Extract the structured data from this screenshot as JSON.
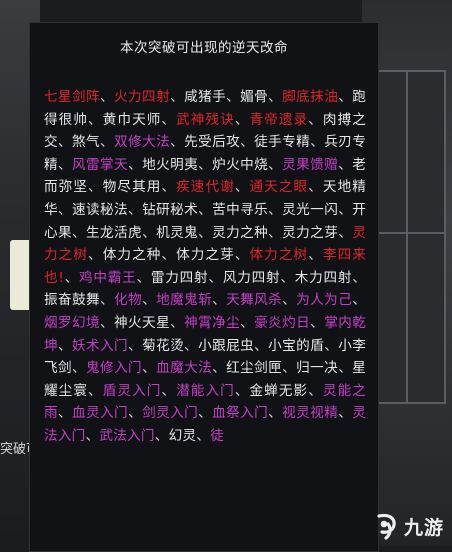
{
  "panel": {
    "title": "本次突破可出现的逆天改命"
  },
  "background": {
    "caption": "突破可"
  },
  "colors": {
    "red": "#e0242a",
    "purple": "#c43ec8",
    "white": "#e6e6e6",
    "separator": "#d4d4d4"
  },
  "separator": "、",
  "skills": [
    {
      "name": "七星剑阵",
      "color": "red"
    },
    {
      "name": "火力四射",
      "color": "red"
    },
    {
      "name": "咸猪手",
      "color": "white"
    },
    {
      "name": "媚骨",
      "color": "white"
    },
    {
      "name": "脚底抹油",
      "color": "red"
    },
    {
      "name": "跑得很帅",
      "color": "white"
    },
    {
      "name": "黄巾天师",
      "color": "white"
    },
    {
      "name": "武神残诀",
      "color": "red"
    },
    {
      "name": "青帝遗录",
      "color": "red"
    },
    {
      "name": "肉搏之交",
      "color": "white"
    },
    {
      "name": "煞气",
      "color": "white"
    },
    {
      "name": "双修大法",
      "color": "purple"
    },
    {
      "name": "先受后攻",
      "color": "white"
    },
    {
      "name": "徒手专精",
      "color": "white"
    },
    {
      "name": "兵刃专精",
      "color": "white"
    },
    {
      "name": "风雷掌天",
      "color": "purple"
    },
    {
      "name": "地火明夷",
      "color": "white"
    },
    {
      "name": "炉火中烧",
      "color": "white"
    },
    {
      "name": "灵果馈赠",
      "color": "purple"
    },
    {
      "name": "老而弥坚",
      "color": "white"
    },
    {
      "name": "物尽其用",
      "color": "white"
    },
    {
      "name": "疾速代谢",
      "color": "red"
    },
    {
      "name": "通天之眼",
      "color": "red"
    },
    {
      "name": "天地精华",
      "color": "white"
    },
    {
      "name": "速读秘法",
      "color": "white"
    },
    {
      "name": "钻研秘术",
      "color": "white"
    },
    {
      "name": "苦中寻乐",
      "color": "white"
    },
    {
      "name": "灵光一闪",
      "color": "white"
    },
    {
      "name": "开心果",
      "color": "white"
    },
    {
      "name": "生龙活虎",
      "color": "white"
    },
    {
      "name": "机灵鬼",
      "color": "white"
    },
    {
      "name": "灵力之种",
      "color": "white"
    },
    {
      "name": "灵力之芽",
      "color": "white"
    },
    {
      "name": "灵力之树",
      "color": "red"
    },
    {
      "name": "体力之种",
      "color": "white"
    },
    {
      "name": "体力之芽",
      "color": "white"
    },
    {
      "name": "体力之树",
      "color": "red"
    },
    {
      "name": "李四来也!",
      "color": "red"
    },
    {
      "name": "鸡中霸王",
      "color": "purple"
    },
    {
      "name": "雷力四射",
      "color": "white"
    },
    {
      "name": "风力四射",
      "color": "white"
    },
    {
      "name": "木力四射",
      "color": "white"
    },
    {
      "name": "振奋鼓舞",
      "color": "white"
    },
    {
      "name": "化物",
      "color": "purple"
    },
    {
      "name": "地魔鬼斩",
      "color": "purple"
    },
    {
      "name": "天舞风杀",
      "color": "purple"
    },
    {
      "name": "为人为己",
      "color": "purple"
    },
    {
      "name": "烟罗幻境",
      "color": "purple"
    },
    {
      "name": "神火天星",
      "color": "white"
    },
    {
      "name": "神霄净尘",
      "color": "purple"
    },
    {
      "name": "豪炎灼日",
      "color": "purple"
    },
    {
      "name": "掌内乾坤",
      "color": "purple"
    },
    {
      "name": "妖术入门",
      "color": "purple"
    },
    {
      "name": "菊花烫",
      "color": "white"
    },
    {
      "name": "小跟屁虫",
      "color": "white"
    },
    {
      "name": "小宝的盾",
      "color": "white"
    },
    {
      "name": "小李飞剑",
      "color": "white"
    },
    {
      "name": "鬼修入门",
      "color": "purple"
    },
    {
      "name": "血魔大法",
      "color": "purple"
    },
    {
      "name": "红尘剑匣",
      "color": "white"
    },
    {
      "name": "归一决",
      "color": "white"
    },
    {
      "name": "星耀尘寰",
      "color": "white"
    },
    {
      "name": "盾灵入门",
      "color": "purple"
    },
    {
      "name": "潜能入门",
      "color": "purple"
    },
    {
      "name": "金蝉无影",
      "color": "white"
    },
    {
      "name": "灵能之雨",
      "color": "purple"
    },
    {
      "name": "血灵入门",
      "color": "purple"
    },
    {
      "name": "剑灵入门",
      "color": "purple"
    },
    {
      "name": "血祭入门",
      "color": "purple"
    },
    {
      "name": "视灵视精",
      "color": "purple"
    },
    {
      "name": "灵法入门",
      "color": "purple"
    },
    {
      "name": "武法入门",
      "color": "purple"
    },
    {
      "name": "幻灵",
      "color": "white"
    },
    {
      "name": "徒",
      "color": "purple"
    }
  ],
  "watermark": {
    "text": "九游",
    "logo_icon": "nine-game-logo-icon"
  }
}
